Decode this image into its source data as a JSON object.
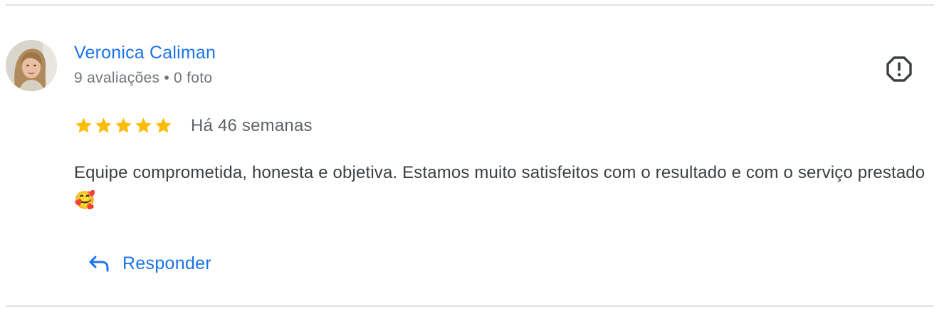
{
  "review": {
    "author": {
      "name": "Veronica Caliman",
      "review_count": "9 avaliações",
      "separator": "•",
      "photo_count": "0 foto"
    },
    "rating": 5,
    "rating_max": 5,
    "time": "Há 46 semanas",
    "text": "Equipe comprometida, honesta e objetiva. Estamos muito satisfeitos com o resultado e com o serviço prestado 🥰"
  },
  "actions": {
    "reply_label": "Responder",
    "flag_icon": "report-flag-icon",
    "reply_icon": "reply-arrow-icon"
  },
  "colors": {
    "link_blue": "#1a73e8",
    "star_gold": "#fbbc04",
    "meta_gray": "#70757a",
    "text_dark": "#3c4043"
  }
}
